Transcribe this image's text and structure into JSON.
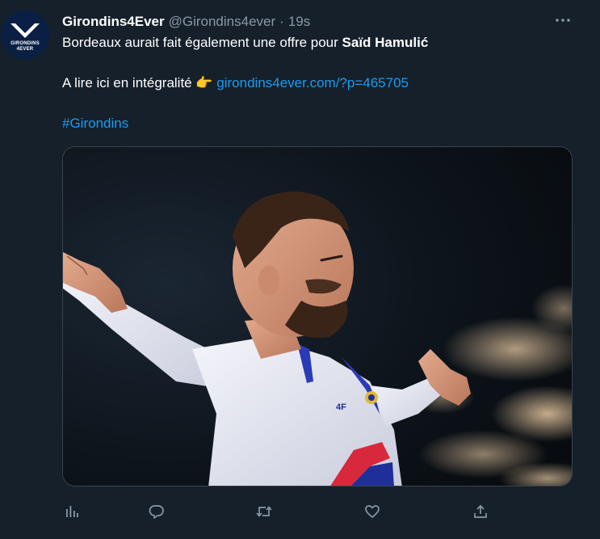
{
  "tweet": {
    "avatar": {
      "line1": "GIRONDINS",
      "line2": "4EVER"
    },
    "display_name": "Girondins4Ever",
    "handle": "@Girondins4ever",
    "separator": "·",
    "time": "19s",
    "text_line1_prefix": "Bordeaux aurait fait également une offre pour ",
    "text_line1_bold": "Saïd Hamulić",
    "text_line2_prefix": "A lire ici en intégralité ",
    "text_line2_emoji": "👉",
    "text_line2_link": "girondins4ever.com/?p=465705",
    "hashtag": "#Girondins"
  },
  "icons": {
    "more": "more-horizontal-icon",
    "analytics": "analytics-icon",
    "reply": "reply-icon",
    "retweet": "retweet-icon",
    "like": "heart-icon",
    "share": "share-icon"
  },
  "colors": {
    "background": "#15202b",
    "text_primary": "#ffffff",
    "text_secondary": "#8b98a5",
    "link": "#1d9bf0",
    "border": "#38444d"
  }
}
